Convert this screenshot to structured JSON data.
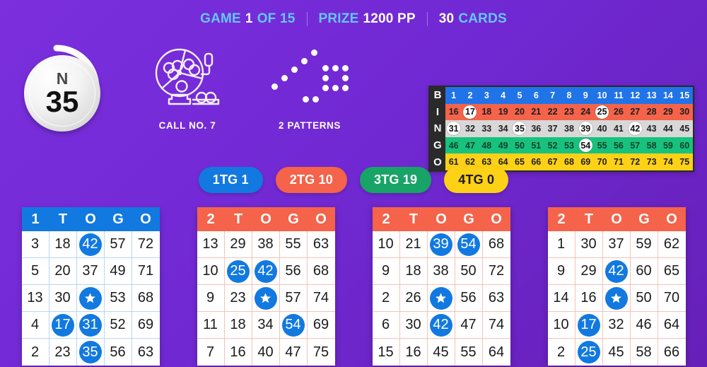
{
  "header": {
    "game_label": "GAME",
    "game_value": "1",
    "game_of": "OF 15",
    "prize_label": "PRIZE",
    "prize_value": "1200 PP",
    "cards_value": "30",
    "cards_label": "CARDS",
    "accent_color": "#62c9f5"
  },
  "current_ball": {
    "letter": "N",
    "number": "35"
  },
  "stats": {
    "call": {
      "icon": "bingo-cage-icon",
      "label": "CALL NO. 7"
    },
    "patterns": {
      "icon": "patterns-dots-icon",
      "label": "2 PATTERNS"
    }
  },
  "board": {
    "rows": [
      {
        "letter": "B",
        "color": "#2173e8",
        "numbers": [
          1,
          2,
          3,
          4,
          5,
          6,
          7,
          8,
          9,
          10,
          11,
          12,
          13,
          14,
          15
        ],
        "called": []
      },
      {
        "letter": "I",
        "color": "#f4634a",
        "numbers": [
          16,
          17,
          18,
          19,
          20,
          21,
          22,
          23,
          24,
          25,
          26,
          27,
          28,
          29,
          30
        ],
        "called": [
          17,
          25
        ]
      },
      {
        "letter": "N",
        "color": "#d8d8d8",
        "numbers": [
          31,
          32,
          33,
          34,
          35,
          36,
          37,
          38,
          39,
          40,
          41,
          42,
          43,
          44,
          45
        ],
        "called": [
          31,
          35,
          39,
          42
        ]
      },
      {
        "letter": "G",
        "color": "#17c27e",
        "numbers": [
          46,
          47,
          48,
          49,
          50,
          51,
          52,
          53,
          54,
          55,
          56,
          57,
          58,
          59,
          60
        ],
        "called": [
          54
        ]
      },
      {
        "letter": "O",
        "color": "#fcd116",
        "numbers": [
          61,
          62,
          63,
          64,
          65,
          66,
          67,
          68,
          69,
          70,
          71,
          72,
          73,
          74,
          75
        ],
        "called": []
      }
    ]
  },
  "badges": [
    {
      "label": "1TG 1",
      "bg": "#1279e0",
      "fg": "#ffffff"
    },
    {
      "label": "2TG 10",
      "bg": "#f4634a",
      "fg": "#ffffff"
    },
    {
      "label": "3TG 19",
      "bg": "#17a466",
      "fg": "#ffffff"
    },
    {
      "label": "4TG 0",
      "bg": "#fcd116",
      "fg": "#1b1b1b"
    }
  ],
  "cards": [
    {
      "head": [
        "1",
        "T",
        "O",
        "G",
        "O"
      ],
      "head_bg": "#1279e0",
      "grid_line": "#b9d6f5",
      "rows": [
        [
          {
            "v": "3"
          },
          {
            "v": "18"
          },
          {
            "v": "42",
            "m": true
          },
          {
            "v": "57"
          },
          {
            "v": "72"
          }
        ],
        [
          {
            "v": "5"
          },
          {
            "v": "20"
          },
          {
            "v": "37"
          },
          {
            "v": "49"
          },
          {
            "v": "71"
          }
        ],
        [
          {
            "v": "13"
          },
          {
            "v": "30"
          },
          {
            "v": "FREE",
            "free": true
          },
          {
            "v": "53"
          },
          {
            "v": "68"
          }
        ],
        [
          {
            "v": "4"
          },
          {
            "v": "17",
            "m": true
          },
          {
            "v": "31",
            "m": true
          },
          {
            "v": "52"
          },
          {
            "v": "69"
          }
        ],
        [
          {
            "v": "2"
          },
          {
            "v": "23"
          },
          {
            "v": "35",
            "m": true
          },
          {
            "v": "56"
          },
          {
            "v": "63"
          }
        ]
      ]
    },
    {
      "head": [
        "2",
        "T",
        "O",
        "G",
        "O"
      ],
      "head_bg": "#f4634a",
      "grid_line": "#f5c2b8",
      "rows": [
        [
          {
            "v": "13"
          },
          {
            "v": "29"
          },
          {
            "v": "38"
          },
          {
            "v": "55"
          },
          {
            "v": "63"
          }
        ],
        [
          {
            "v": "10"
          },
          {
            "v": "25",
            "m": true
          },
          {
            "v": "42",
            "m": true
          },
          {
            "v": "56"
          },
          {
            "v": "68"
          }
        ],
        [
          {
            "v": "9"
          },
          {
            "v": "23"
          },
          {
            "v": "FREE",
            "free": true
          },
          {
            "v": "57"
          },
          {
            "v": "74"
          }
        ],
        [
          {
            "v": "11"
          },
          {
            "v": "18"
          },
          {
            "v": "34"
          },
          {
            "v": "54",
            "m": true
          },
          {
            "v": "69"
          }
        ],
        [
          {
            "v": "7"
          },
          {
            "v": "16"
          },
          {
            "v": "40"
          },
          {
            "v": "47"
          },
          {
            "v": "75"
          }
        ]
      ]
    },
    {
      "head": [
        "2",
        "T",
        "O",
        "G",
        "O"
      ],
      "head_bg": "#f4634a",
      "grid_line": "#f5c2b8",
      "rows": [
        [
          {
            "v": "10"
          },
          {
            "v": "21"
          },
          {
            "v": "39",
            "m": true
          },
          {
            "v": "54",
            "m": true
          },
          {
            "v": "68"
          }
        ],
        [
          {
            "v": "9"
          },
          {
            "v": "18"
          },
          {
            "v": "38"
          },
          {
            "v": "50"
          },
          {
            "v": "72"
          }
        ],
        [
          {
            "v": "2"
          },
          {
            "v": "26"
          },
          {
            "v": "FREE",
            "free": true
          },
          {
            "v": "56"
          },
          {
            "v": "63"
          }
        ],
        [
          {
            "v": "6"
          },
          {
            "v": "30"
          },
          {
            "v": "42",
            "m": true
          },
          {
            "v": "47"
          },
          {
            "v": "74"
          }
        ],
        [
          {
            "v": "15"
          },
          {
            "v": "16"
          },
          {
            "v": "45"
          },
          {
            "v": "55"
          },
          {
            "v": "64"
          }
        ]
      ]
    },
    {
      "head": [
        "2",
        "T",
        "O",
        "G",
        "O"
      ],
      "head_bg": "#f4634a",
      "grid_line": "#f5c2b8",
      "rows": [
        [
          {
            "v": "1"
          },
          {
            "v": "30"
          },
          {
            "v": "37"
          },
          {
            "v": "59"
          },
          {
            "v": "62"
          }
        ],
        [
          {
            "v": "9"
          },
          {
            "v": "29"
          },
          {
            "v": "42",
            "m": true
          },
          {
            "v": "60"
          },
          {
            "v": "65"
          }
        ],
        [
          {
            "v": "14"
          },
          {
            "v": "16"
          },
          {
            "v": "FREE",
            "free": true
          },
          {
            "v": "50"
          },
          {
            "v": "70"
          }
        ],
        [
          {
            "v": "10"
          },
          {
            "v": "17",
            "m": true
          },
          {
            "v": "32"
          },
          {
            "v": "46"
          },
          {
            "v": "64"
          }
        ],
        [
          {
            "v": "2"
          },
          {
            "v": "25",
            "m": true
          },
          {
            "v": "45"
          },
          {
            "v": "58"
          },
          {
            "v": "66"
          }
        ]
      ]
    }
  ]
}
